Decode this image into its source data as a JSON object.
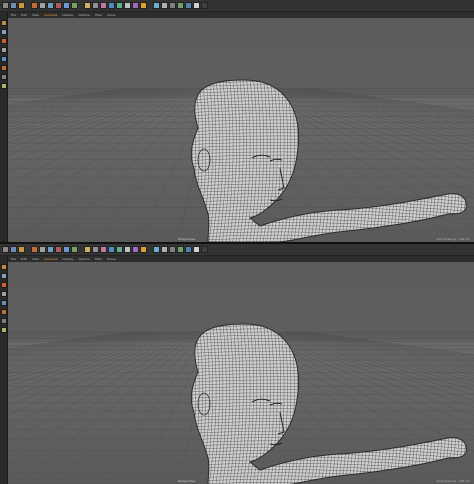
{
  "app": {
    "toolbar_colors": [
      "#8a8a8a",
      "#6d8fb5",
      "#c89540",
      "#c06d3a",
      "#a0a0a0",
      "#6da0c0",
      "#b05a5a",
      "#6a9ad0",
      "#7aa060",
      "#d0b060",
      "#909090",
      "#c07aa0",
      "#4f8ac0",
      "#5fb08a",
      "#c0c0c0",
      "#9a6dc0",
      "#e0a030",
      "#6ab0d0",
      "#b0b0b0",
      "#808080",
      "#70a070",
      "#5080b0",
      "#d0d0d0",
      "#404040"
    ],
    "left_tool_colors": [
      "#c08a40",
      "#8aa0c0",
      "#d06030",
      "#a0a0a0",
      "#6090c0",
      "#c07030",
      "#808080",
      "#b0b060"
    ],
    "accent_color": "#f0a040"
  },
  "viewports": [
    {
      "menu": [
        "File",
        "Edit",
        "View",
        "Cameras",
        "Display",
        "Options",
        "Filter",
        "Panel"
      ],
      "active_menu_index": 3,
      "mode_label": "Perspective",
      "status_text": "Grid Spacing : 100 cm"
    },
    {
      "menu": [
        "File",
        "Edit",
        "View",
        "Cameras",
        "Display",
        "Options",
        "Filter",
        "Panel"
      ],
      "active_menu_index": 3,
      "mode_label": "Perspective",
      "status_text": "Grid Spacing : 100 cm"
    }
  ]
}
